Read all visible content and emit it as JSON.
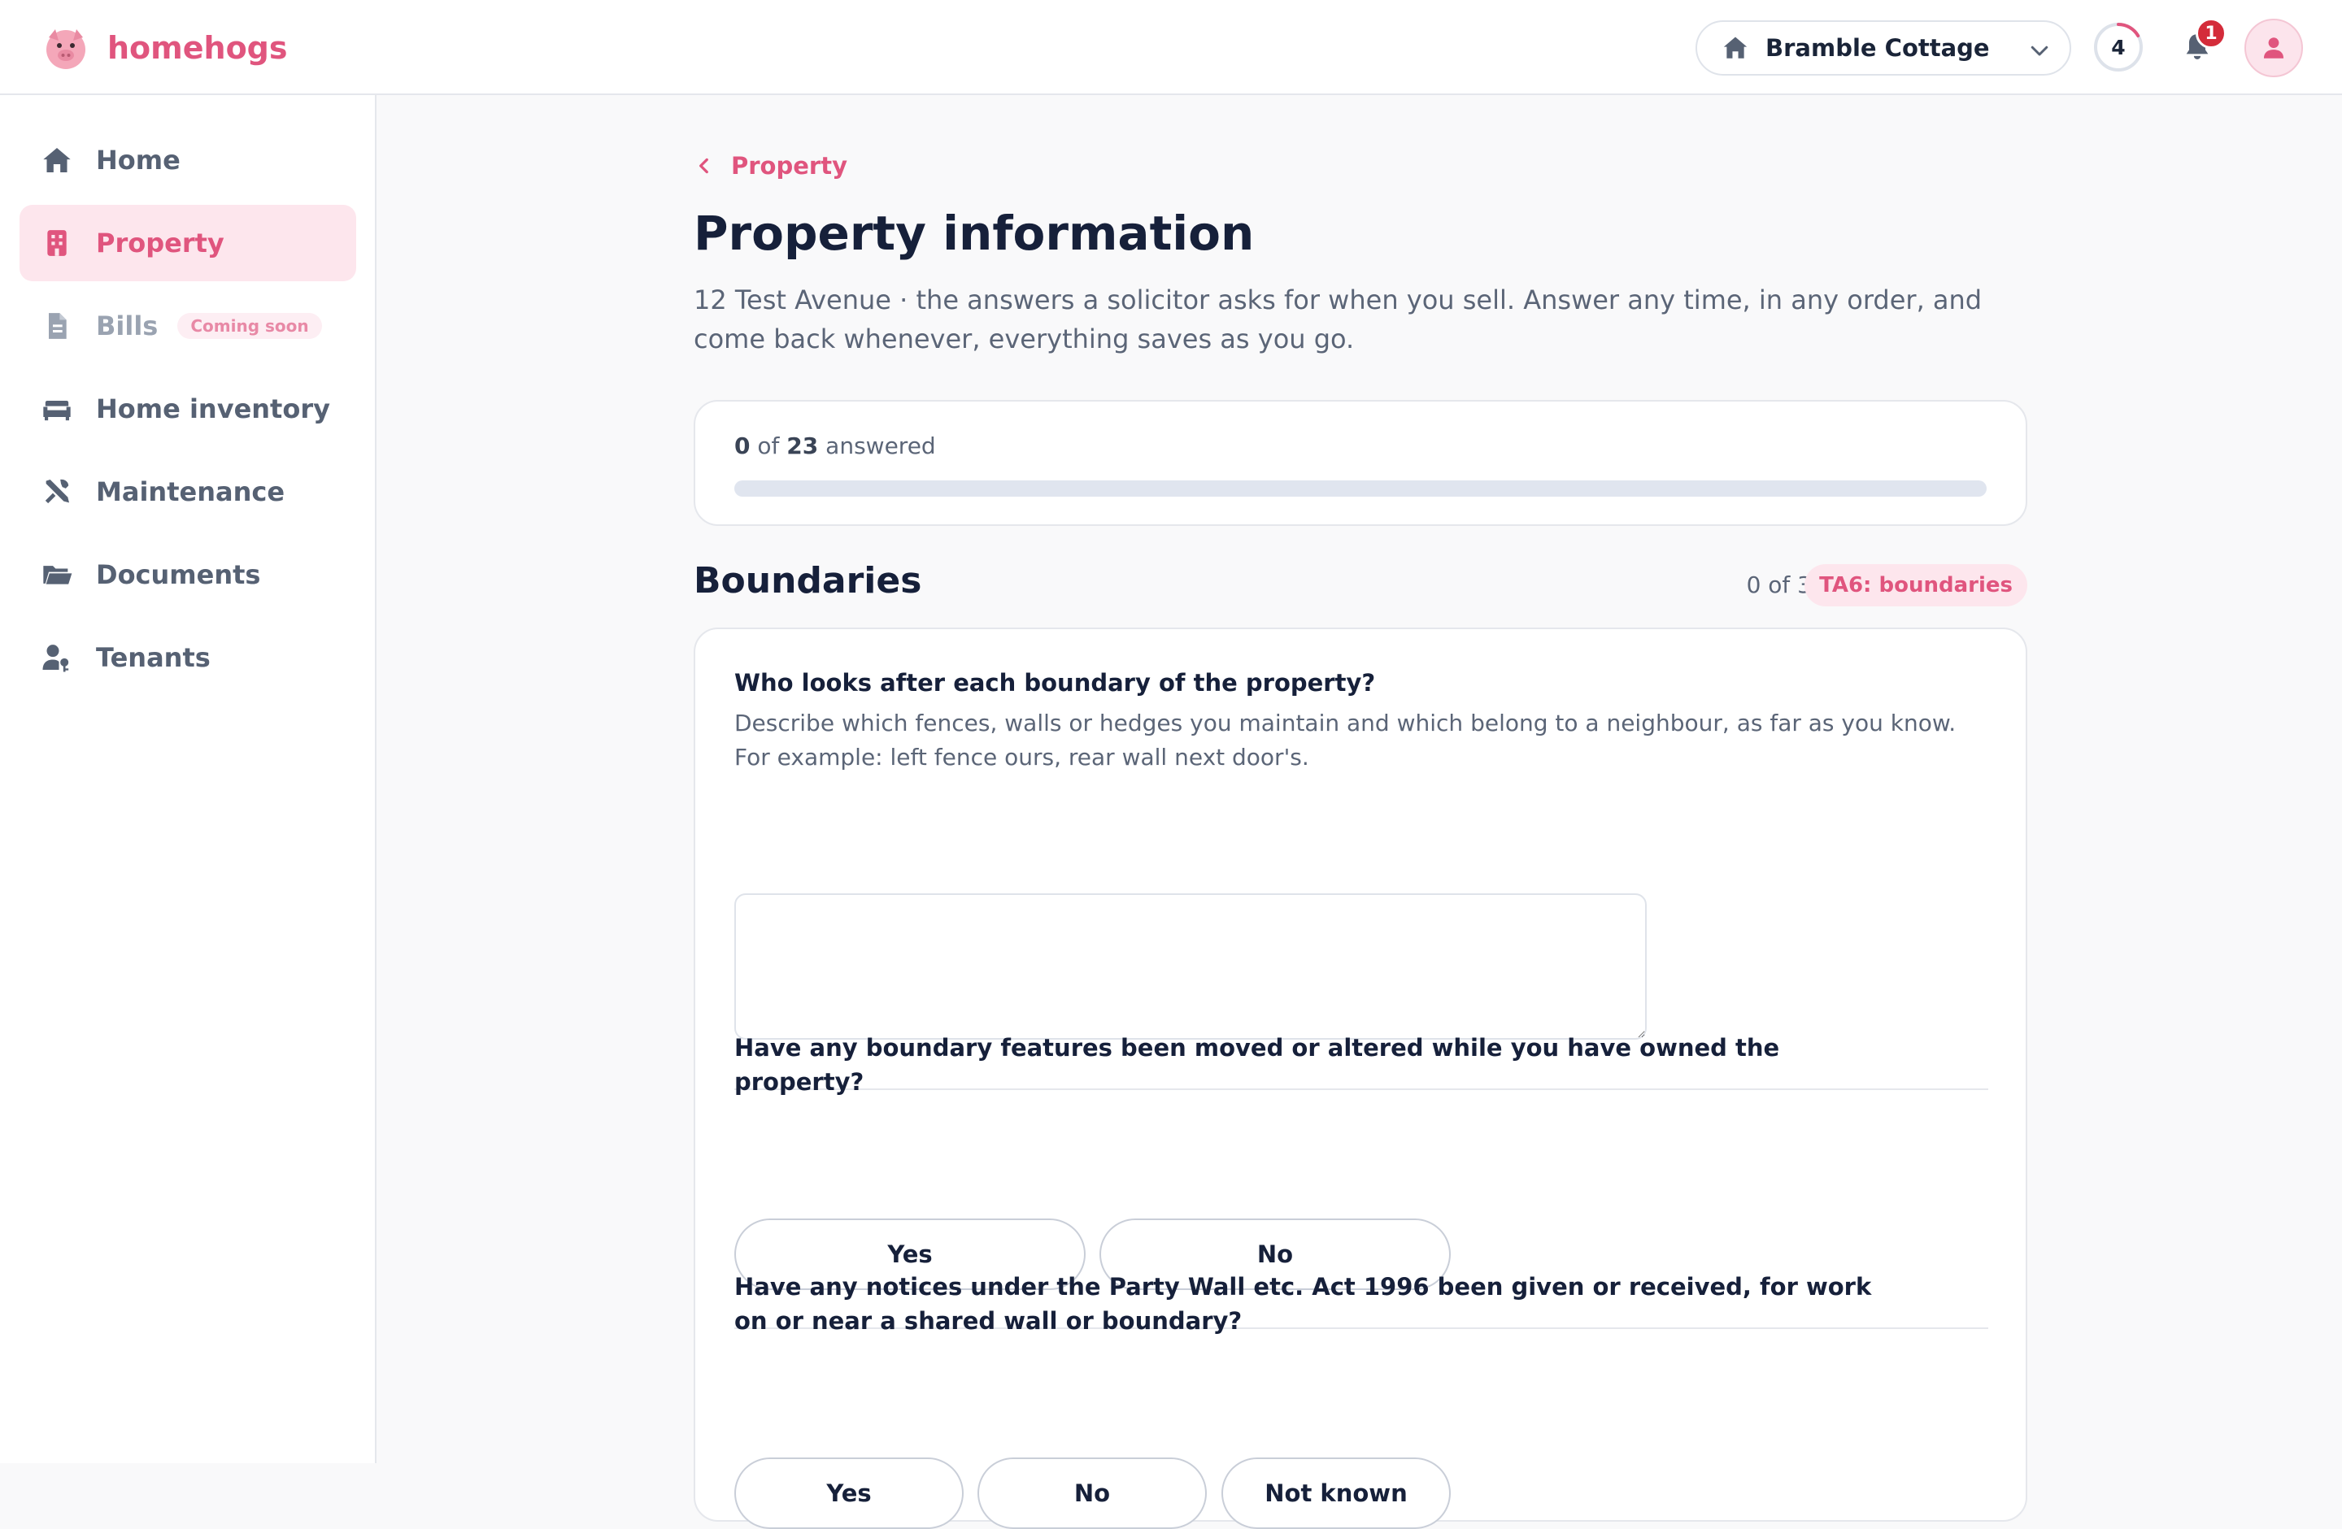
{
  "app": {
    "name": "homehogs"
  },
  "header": {
    "property_selector": {
      "value": "Bramble Cottage"
    },
    "progress_count": "4",
    "notifications_count": "1"
  },
  "sidebar": {
    "items": [
      {
        "label": "Home",
        "icon": "home-icon"
      },
      {
        "label": "Property",
        "icon": "building-icon",
        "active": true
      },
      {
        "label": "Bills",
        "icon": "file-icon",
        "badge": "Coming soon",
        "disabled": true
      },
      {
        "label": "Home inventory",
        "icon": "couch-icon"
      },
      {
        "label": "Maintenance",
        "icon": "tools-icon"
      },
      {
        "label": "Documents",
        "icon": "folder-icon"
      },
      {
        "label": "Tenants",
        "icon": "user-key-icon"
      }
    ]
  },
  "main": {
    "breadcrumb": "Property",
    "title": "Property information",
    "subtitle": "12 Test Avenue · the answers a solicitor asks for when you sell. Answer any time, in any order, and come back whenever, everything saves as you go.",
    "progress": {
      "answered": "0",
      "of_label": "of",
      "total": "23",
      "suffix": "answered",
      "fraction": 0
    },
    "section": {
      "title": "Boundaries",
      "count": "0 of 3",
      "tag": "TA6: boundaries",
      "questions": [
        {
          "label": "Who looks after each boundary of the property?",
          "help_1": "Describe which fences, walls or hedges you maintain and which belong to a neighbour, as far as you know.",
          "help_2": "For example: left fence ours, rear wall next door's.",
          "value": ""
        },
        {
          "label_1": "Have any boundary features been moved or altered while you have owned the",
          "label_2": "property?",
          "options": [
            "Yes",
            "No"
          ]
        },
        {
          "label_1": "Have any notices under the Party Wall etc. Act 1996 been given or received, for work",
          "label_2": "on or near a shared wall or boundary?",
          "options": [
            "Yes",
            "No",
            "Not known"
          ]
        }
      ]
    }
  },
  "colors": {
    "accent": "#e0557e",
    "accent_soft": "#fde6ed",
    "badge_red": "#d42c3a",
    "text_dark": "#16203a",
    "text_muted": "#5b6577"
  }
}
